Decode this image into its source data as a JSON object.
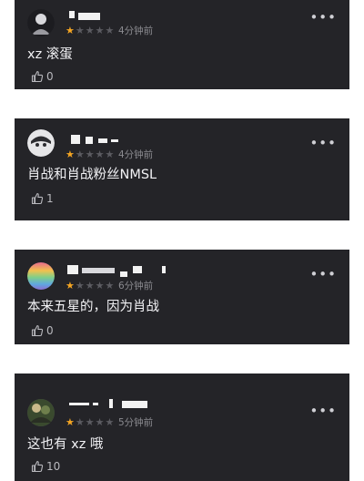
{
  "icons": {
    "thumbs_up": "thumbs-up-icon",
    "more": "more-horizontal-icon"
  },
  "colors": {
    "card_bg": "#242428",
    "star_on": "#f5a623",
    "star_off": "#5c5c62"
  },
  "more_glyph": "•••",
  "comments": [
    {
      "stars_on": "★",
      "stars_off": "★★★★",
      "time": "4分钟前",
      "text": "xz 滚蛋",
      "likes": "0"
    },
    {
      "stars_on": "★",
      "stars_off": "★★★★",
      "time": "4分钟前",
      "text": "肖战和肖战粉丝NMSL",
      "likes": "1"
    },
    {
      "stars_on": "★",
      "stars_off": "★★★★",
      "time": "6分钟前",
      "text": "本来五星的，因为肖战",
      "likes": "0"
    },
    {
      "stars_on": "★",
      "stars_off": "★★★★",
      "time": "5分钟前",
      "text": "这也有 xz 哦",
      "likes": "10"
    }
  ]
}
